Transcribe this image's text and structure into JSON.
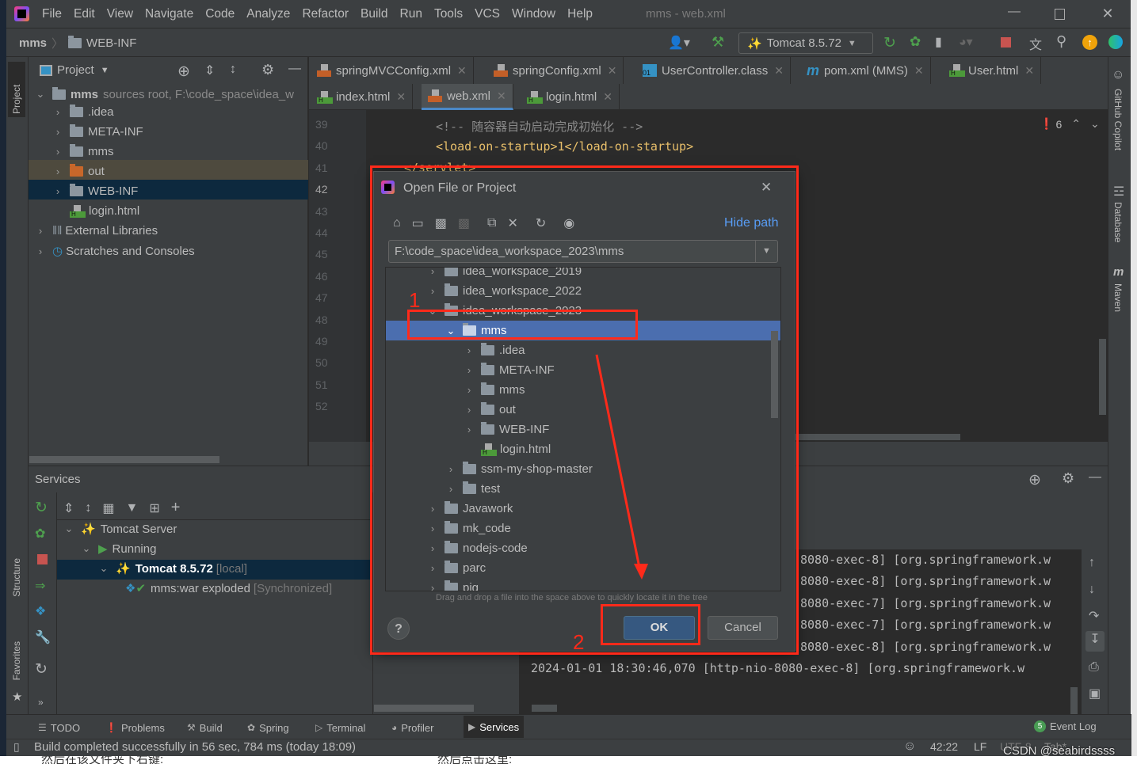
{
  "window": {
    "title": "mms - web.xml",
    "menu": [
      "File",
      "Edit",
      "View",
      "Navigate",
      "Code",
      "Analyze",
      "Refactor",
      "Build",
      "Run",
      "Tools",
      "VCS",
      "Window",
      "Help"
    ]
  },
  "breadcrumb": [
    "mms",
    "WEB-INF"
  ],
  "toolbar": {
    "run_config": "Tomcat 8.5.72"
  },
  "project": {
    "title": "Project",
    "root": "mms",
    "root_hint": "sources root,  F:\\code_space\\idea_w",
    "items": [
      {
        "label": ".idea",
        "level": 1,
        "icon": "folder"
      },
      {
        "label": "META-INF",
        "level": 1,
        "icon": "folder"
      },
      {
        "label": "mms",
        "level": 1,
        "icon": "folder"
      },
      {
        "label": "out",
        "level": 1,
        "icon": "folder-orange"
      },
      {
        "label": "WEB-INF",
        "level": 1,
        "icon": "folder"
      },
      {
        "label": "login.html",
        "level": 1,
        "icon": "html"
      },
      {
        "label": "External Libraries",
        "level": 0,
        "icon": "library"
      },
      {
        "label": "Scratches and Consoles",
        "level": 0,
        "icon": "scratch"
      }
    ]
  },
  "tabs_row1": [
    {
      "label": "springMVCConfig.xml",
      "icon": "xml"
    },
    {
      "label": "springConfig.xml",
      "icon": "xml"
    },
    {
      "label": "UserController.class",
      "icon": "class"
    },
    {
      "label": "pom.xml (MMS)",
      "icon": "maven"
    },
    {
      "label": "User.html",
      "icon": "html"
    }
  ],
  "tabs_row2": [
    {
      "label": "index.html",
      "icon": "html"
    },
    {
      "label": "web.xml",
      "icon": "xml",
      "active": true
    },
    {
      "label": "login.html",
      "icon": "html"
    }
  ],
  "editor": {
    "line_numbers": [
      "39",
      "40",
      "41",
      "42",
      "43",
      "44",
      "45",
      "46",
      "47",
      "48",
      "49",
      "50",
      "51",
      "52"
    ],
    "lines": [
      "<!-- 随容器自动启动完成初始化 -->",
      "<load-on-startup>1</load-on-startup>",
      "</servlet>"
    ],
    "error_count": "6"
  },
  "right_strip": [
    "GitHub Copilot",
    "Database",
    "Maven"
  ],
  "left_strip": [
    "Project",
    "Structure",
    "Favorites"
  ],
  "dialog": {
    "title": "Open File or Project",
    "hide_path": "Hide path",
    "path": "F:\\code_space\\idea_workspace_2023\\mms",
    "tree": [
      {
        "label": "idea_workspace_2019",
        "level": 0,
        "open": false
      },
      {
        "label": "idea_workspace_2022",
        "level": 0,
        "open": false
      },
      {
        "label": "idea_workspace_2023",
        "level": 0,
        "open": true
      },
      {
        "label": "mms",
        "level": 1,
        "open": true,
        "selected": true
      },
      {
        "label": ".idea",
        "level": 2,
        "open": false
      },
      {
        "label": "META-INF",
        "level": 2,
        "open": false
      },
      {
        "label": "mms",
        "level": 2,
        "open": false
      },
      {
        "label": "out",
        "level": 2,
        "open": false
      },
      {
        "label": "WEB-INF",
        "level": 2,
        "open": false
      },
      {
        "label": "login.html",
        "level": 2,
        "file": true
      },
      {
        "label": "ssm-my-shop-master",
        "level": 1,
        "open": false
      },
      {
        "label": "test",
        "level": 1,
        "open": false
      },
      {
        "label": "Javawork",
        "level": 0,
        "open": false
      },
      {
        "label": "mk_code",
        "level": 0,
        "open": false
      },
      {
        "label": "nodejs-code",
        "level": 0,
        "open": false
      },
      {
        "label": "parc",
        "level": 0,
        "open": false
      },
      {
        "label": "pig",
        "level": 0,
        "open": false
      }
    ],
    "hint": "Drag and drop a file into the space above to quickly locate it in the tree",
    "ok": "OK",
    "cancel": "Cancel",
    "help": "?"
  },
  "annotations": {
    "step1": "1",
    "step2": "2",
    "color": "#ff2a1a"
  },
  "services": {
    "title": "Services",
    "tree": [
      {
        "label": "Tomcat Server",
        "level": 0
      },
      {
        "label": "Running",
        "level": 1
      },
      {
        "label": "Tomcat 8.5.72",
        "suffix": "[local]",
        "level": 2,
        "selected": true
      },
      {
        "label": "mms:war exploded",
        "suffix": "[Synchronized]",
        "level": 3
      }
    ],
    "console": [
      "8080-exec-8] [org.springframework.w",
      "8080-exec-8] [org.springframework.w",
      "8080-exec-7] [org.springframework.w",
      "8080-exec-7] [org.springframework.w",
      "8080-exec-8] [org.springframework.w",
      "2024-01-01 18:30:46,070 [http-nio-8080-exec-8] [org.springframework.w"
    ]
  },
  "bottom_tools": [
    "TODO",
    "Problems",
    "Build",
    "Spring",
    "Terminal",
    "Profiler",
    "Services"
  ],
  "event_log": {
    "count": "5",
    "label": "Event Log"
  },
  "status": {
    "message": "Build completed successfully in 56 sec, 784 ms (today 18:09)",
    "position": "42:22",
    "line_sep": "LF",
    "encoding": "UTF-8",
    "indent": "Tab*"
  },
  "watermark": "CSDN @seabirdssss",
  "below": [
    "然后在该文件夹下右键:",
    "然后点击这里:"
  ]
}
